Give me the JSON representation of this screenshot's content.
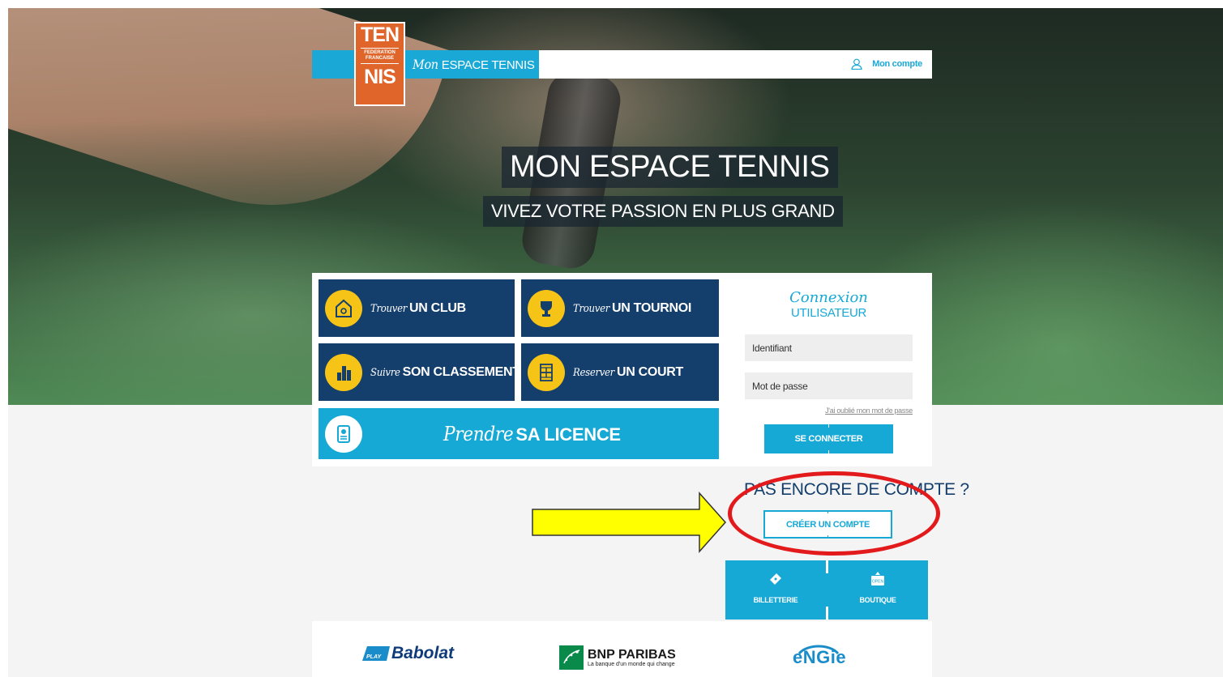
{
  "header": {
    "title_script": "Mon",
    "title_main": "ESPACE TENNIS",
    "account_label": "Mon compte",
    "account_icon": "user-icon"
  },
  "logo": {
    "line1": "TEN",
    "line2a": "FEDERATION",
    "line2b": "FRANCAISE",
    "line3": "NIS"
  },
  "hero": {
    "title": "MON ESPACE TENNIS",
    "subtitle": "VIVEZ VOTRE PASSION EN PLUS GRAND"
  },
  "actions": [
    {
      "script": "Trouver",
      "bold": "UN CLUB",
      "icon": "club-house-icon"
    },
    {
      "script": "Trouver",
      "bold": "UN TOURNOI",
      "icon": "trophy-icon"
    },
    {
      "script": "Suivre",
      "bold": "SON CLASSEMENT",
      "icon": "ranking-icon"
    },
    {
      "script": "Reserver",
      "bold": "UN COURT",
      "icon": "court-icon"
    },
    {
      "script": "Prendre",
      "bold": "SA LICENCE",
      "icon": "licence-card-icon"
    }
  ],
  "login": {
    "title_script": "Connexion",
    "title_main": "UTILISATEUR",
    "username_placeholder": "Identifiant",
    "password_placeholder": "Mot de passe",
    "forgot_label": "J'ai oublié mon mot de passe",
    "submit_label": "SE CONNECTER"
  },
  "signup": {
    "question": "PAS ENCORE DE COMPTE ?",
    "button_label": "CRÉER UN COMPTE"
  },
  "shortcuts": [
    {
      "label": "BILLETTERIE",
      "icon": "ticket-icon"
    },
    {
      "label": "BOUTIQUE",
      "icon": "shop-open-icon",
      "badge": "OPEN"
    }
  ],
  "sponsors": {
    "babolat": {
      "name": "Babolat",
      "badge": "PLAY"
    },
    "bnp": {
      "name": "BNP PARIBAS",
      "tagline": "La banque d'un monde qui change"
    },
    "engie": {
      "name": "eNGie"
    }
  },
  "colors": {
    "brand_blue": "#1aa9d6",
    "navy": "#143e6b",
    "yellow": "#f6c417",
    "logo_orange": "#e0652a",
    "annotation_red": "#e31a1c",
    "annotation_yellow": "#ffff00"
  }
}
